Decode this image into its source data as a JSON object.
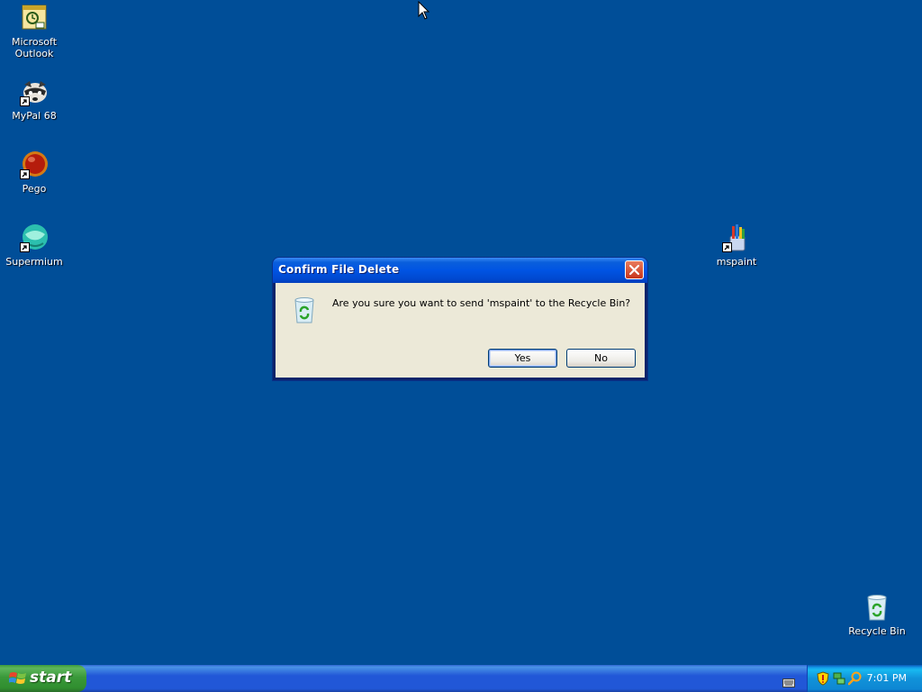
{
  "desktop": {
    "icons": [
      {
        "name": "microsoft-outlook",
        "label": "Microsoft Outlook",
        "icon": "outlook-icon"
      },
      {
        "name": "mypal-68",
        "label": "MyPal 68",
        "icon": "mypal-raccoon-icon"
      },
      {
        "name": "pego",
        "label": "Pego",
        "icon": "pego-red-ball-icon"
      },
      {
        "name": "supermium",
        "label": "Supermium",
        "icon": "supermium-globe-icon"
      },
      {
        "name": "mspaint",
        "label": "mspaint",
        "icon": "mspaint-brushes-icon"
      },
      {
        "name": "recycle-bin",
        "label": "Recycle Bin",
        "icon": "recycle-bin-icon"
      }
    ]
  },
  "dialog": {
    "title": "Confirm File Delete",
    "message": "Are you sure you want to send 'mspaint' to the Recycle Bin?",
    "icon": "recycle-bin-icon",
    "buttons": {
      "yes": "Yes",
      "no": "No"
    },
    "close_icon": "close-icon"
  },
  "taskbar": {
    "start_label": "start",
    "tray_icons": [
      "keyboard-icon",
      "security-shield-icon",
      "network-icon",
      "search-icon"
    ],
    "clock": "7:01 PM"
  },
  "colors": {
    "desktop": "#004e98",
    "title_bar": "#0054e3",
    "dialog_face": "#ece9d8",
    "taskbar": "#2157d7",
    "start_button": "#3a993a",
    "tray": "#0e87d3"
  }
}
